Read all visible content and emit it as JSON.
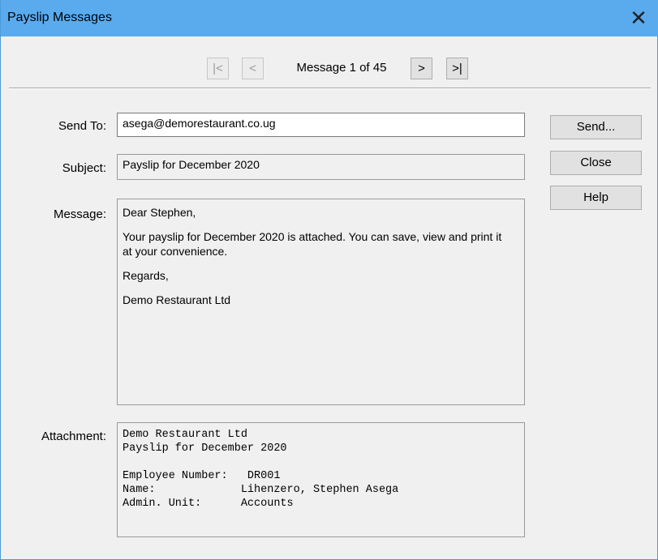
{
  "window": {
    "title": "Payslip Messages",
    "close_glyph": "✕"
  },
  "nav": {
    "first": "|<",
    "prev": "<",
    "status": "Message 1 of 45",
    "next": ">",
    "last": ">|"
  },
  "form": {
    "send_to_label": "Send To:",
    "send_to_value": "asega@demorestaurant.co.ug",
    "subject_label": "Subject:",
    "subject_value": "Payslip for December 2020",
    "message_label": "Message:",
    "message_paragraphs": [
      "Dear Stephen,",
      "Your payslip for December 2020 is attached. You can save, view and print it at your convenience.",
      "Regards,",
      "Demo Restaurant Ltd"
    ],
    "attachment_label": "Attachment:",
    "attachment_lines": [
      "Demo Restaurant Ltd",
      "Payslip for December 2020",
      "",
      "Employee Number:   DR001",
      "Name:             Lihenzero, Stephen Asega",
      "Admin. Unit:      Accounts"
    ]
  },
  "buttons": {
    "send": "Send...",
    "close": "Close",
    "help": "Help"
  }
}
